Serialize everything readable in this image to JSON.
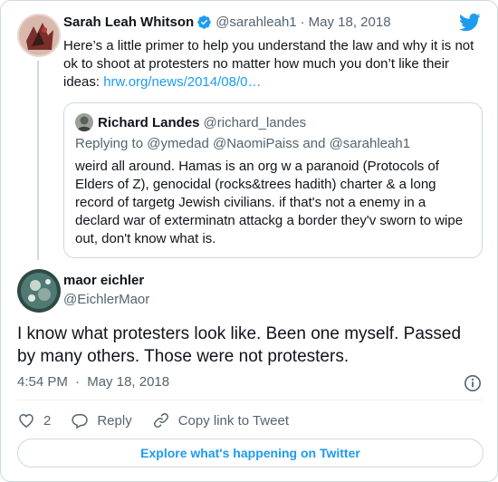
{
  "parent_tweet": {
    "author_name": "Sarah Leah Whitson",
    "handle": "@sarahleah1",
    "separator": "·",
    "date": "May 18, 2018",
    "text": "Here’s a little primer to help you understand the law and why it is not ok to shoot at protesters no matter how much you don’t like their ideas: ",
    "link_text": "hrw.org/news/2014/08/0…",
    "verified_icon": "verified-badge-icon",
    "logo_icon": "twitter-bird-icon"
  },
  "quoted_tweet": {
    "author_name": "Richard Landes",
    "handle": "@richard_landes",
    "replying_to": "Replying to @ymedad @NaomiPaiss and @sarahleah1",
    "text": "weird all around. Hamas is an org w a paranoid (Protocols of Elders of Z), genocidal (rocks&trees hadith) charter & a long record of targetg Jewish civilians. if that's not a enemy in a declard war of exterminatn attackg a border they'v sworn to wipe out, don't know what is."
  },
  "main_tweet": {
    "author_name": "maor eichler",
    "handle": "@EichlerMaor",
    "text": "I know what protesters look like. Been one myself. Passed by many others. Those were not protesters.",
    "time": "4:54 PM",
    "separator": "·",
    "date": "May 18, 2018",
    "info_icon": "info-icon"
  },
  "actions": {
    "like_count": "2",
    "reply_label": "Reply",
    "copy_link_label": "Copy link to Tweet"
  },
  "explore_label": "Explore what's happening on Twitter",
  "colors": {
    "accent": "#1d9bf0",
    "text": "#0f1419",
    "muted": "#536471",
    "border": "#cfd9de"
  }
}
